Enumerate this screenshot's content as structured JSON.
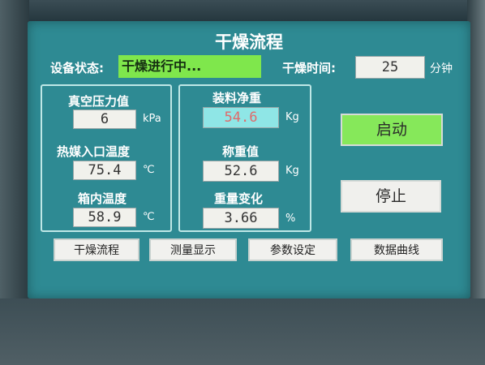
{
  "screen": {
    "title": "干燥流程",
    "status_label": "设备状态:",
    "status_value": "干燥进行中...",
    "dry_time_label": "干燥时间:",
    "dry_time_value": "25",
    "dry_time_unit": "分钟"
  },
  "left_panel": {
    "vacuum_label": "真空压力值",
    "vacuum_value": "6",
    "vacuum_unit": "kPa",
    "inlet_label": "热媒入口温度",
    "inlet_value": "75.4",
    "inlet_unit": "℃",
    "box_temp_label": "箱内温度",
    "box_temp_value": "58.9",
    "box_temp_unit": "℃"
  },
  "center_panel": {
    "net_weight_label": "装料净重",
    "net_weight_value": "54.6",
    "net_weight_unit": "Kg",
    "weigh_label": "称重值",
    "weigh_value": "52.6",
    "weigh_unit": "Kg",
    "change_label": "重量变化",
    "change_value": "3.66",
    "change_unit": "%"
  },
  "buttons": {
    "start": "启动",
    "stop": "停止"
  },
  "nav": {
    "tabs": [
      {
        "label": "干燥流程"
      },
      {
        "label": "测量显示"
      },
      {
        "label": "参数设定"
      },
      {
        "label": "数据曲线"
      }
    ]
  },
  "colors": {
    "screen_bg": "#2e8a93",
    "status_green": "#7fe74c",
    "start_green": "#86e85a",
    "highlight_cyan": "#8fe6e6",
    "highlight_text": "#e06a6a"
  }
}
